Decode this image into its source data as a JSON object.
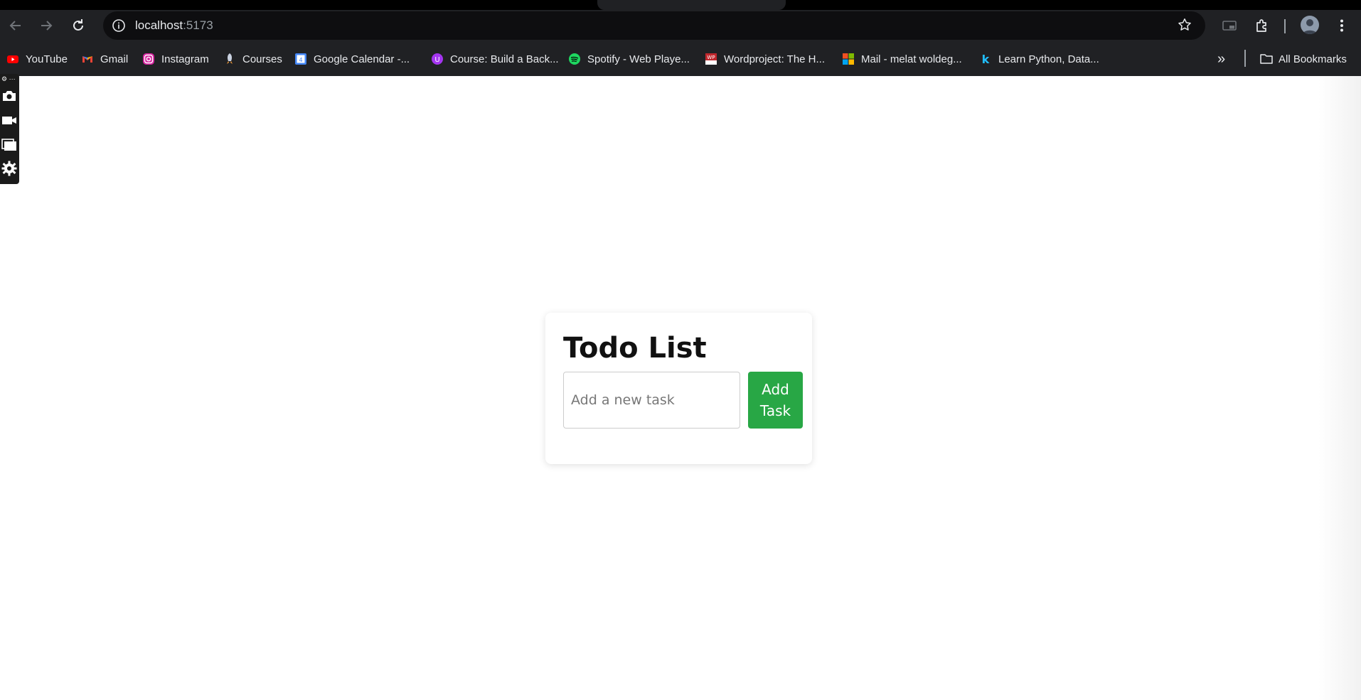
{
  "browser": {
    "url_host": "localhost",
    "url_port": ":5173",
    "icons": [
      "back-icon",
      "forward-icon",
      "reload-icon",
      "site-info-icon",
      "bookmark-star-icon",
      "picture-in-picture-icon",
      "extensions-icon",
      "profile-avatar",
      "more-menu-icon"
    ]
  },
  "bookmarks": {
    "items": [
      {
        "label": "YouTube",
        "icon": "youtube-icon"
      },
      {
        "label": "Gmail",
        "icon": "gmail-icon"
      },
      {
        "label": "Instagram",
        "icon": "instagram-icon"
      },
      {
        "label": "Courses",
        "icon": "rocket-icon"
      },
      {
        "label": "Google Calendar -...",
        "icon": "google-calendar-icon"
      },
      {
        "label": "Course: Build a Back...",
        "icon": "course-icon"
      },
      {
        "label": "Spotify - Web Playe...",
        "icon": "spotify-icon"
      },
      {
        "label": "Wordproject: The H...",
        "icon": "wordproject-icon"
      },
      {
        "label": "Mail - melat woldeg...",
        "icon": "microsoft-icon"
      },
      {
        "label": "Learn Python, Data...",
        "icon": "k-icon"
      }
    ],
    "overflow": "»",
    "all_bookmarks": "All Bookmarks"
  },
  "side_widget": {
    "icons": [
      "camera-icon",
      "video-camera-icon",
      "window-icon",
      "settings-gear-icon"
    ],
    "header": "⚙ ···"
  },
  "todo": {
    "title": "Todo List",
    "input_placeholder": "Add a new task",
    "add_button": "Add Task"
  },
  "colors": {
    "add_button": "#28a745",
    "browser_chrome": "#202124"
  }
}
